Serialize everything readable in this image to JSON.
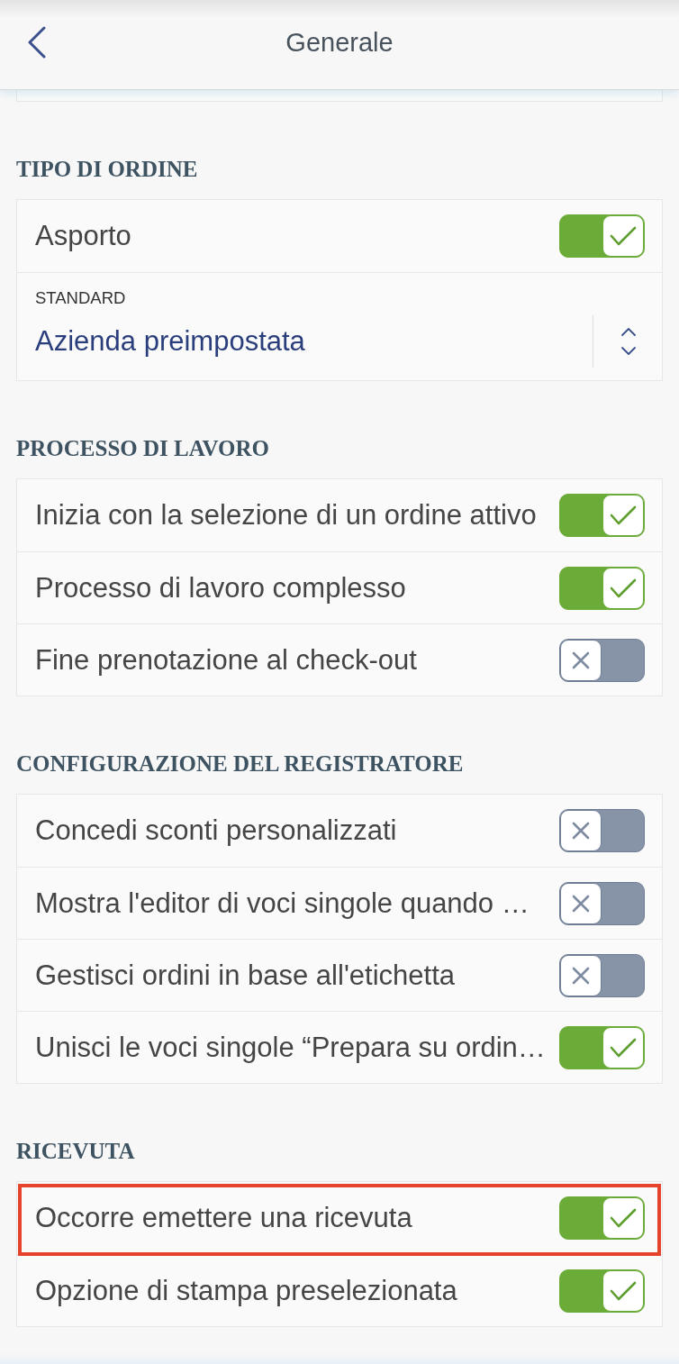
{
  "header": {
    "title": "Generale"
  },
  "sections": [
    {
      "title": "TIPO DI ORDINE",
      "rows": [
        {
          "kind": "toggle",
          "label": "Asporto",
          "on": true,
          "highlighted": false
        },
        {
          "kind": "select",
          "label": "STANDARD",
          "value": "Azienda preimpostata"
        }
      ]
    },
    {
      "title": "PROCESSO DI LAVORO",
      "rows": [
        {
          "kind": "toggle",
          "label": "Inizia con la selezione di un ordine attivo",
          "on": true,
          "highlighted": false
        },
        {
          "kind": "toggle",
          "label": "Processo di lavoro complesso",
          "on": true,
          "highlighted": false
        },
        {
          "kind": "toggle",
          "label": "Fine prenotazione al check-out",
          "on": false,
          "highlighted": false
        }
      ]
    },
    {
      "title": "CONFIGURAZIONE DEL REGISTRATORE",
      "rows": [
        {
          "kind": "toggle",
          "label": "Concedi sconti personalizzati",
          "on": false,
          "highlighted": false
        },
        {
          "kind": "toggle",
          "label": "Mostra l'editor di voci singole quando …",
          "on": false,
          "highlighted": false
        },
        {
          "kind": "toggle",
          "label": "Gestisci ordini in base all'etichetta",
          "on": false,
          "highlighted": false
        },
        {
          "kind": "toggle",
          "label": "Unisci le voci singole “Prepara su ordin…",
          "on": true,
          "highlighted": false
        }
      ]
    },
    {
      "title": "RICEVUTA",
      "rows": [
        {
          "kind": "toggle",
          "label": "Occorre emettere una ricevuta",
          "on": true,
          "highlighted": true
        },
        {
          "kind": "toggle",
          "label": "Opzione di stampa preselezionata",
          "on": true,
          "highlighted": false
        }
      ]
    }
  ]
}
